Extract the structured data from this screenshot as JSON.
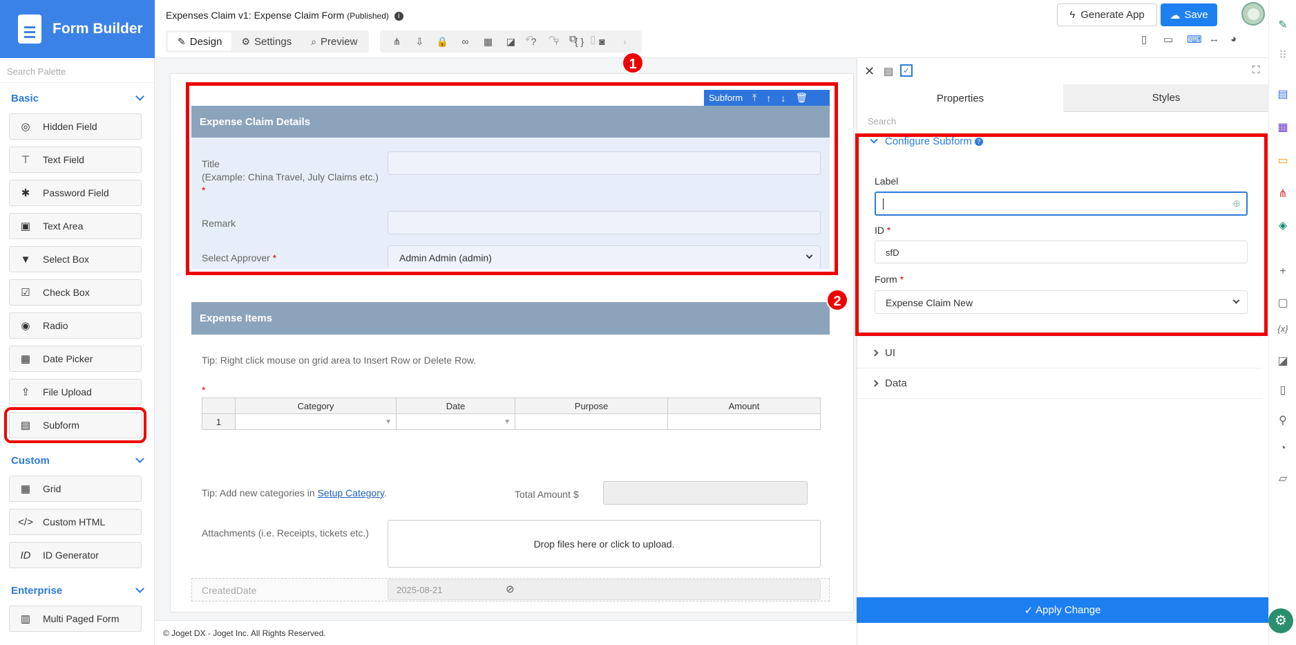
{
  "app": {
    "brand": "Form Builder"
  },
  "palette": {
    "search_placeholder": "Search Palette",
    "sections": {
      "basic": "Basic",
      "custom": "Custom",
      "enterprise": "Enterprise"
    },
    "basic_items": [
      "Hidden Field",
      "Text Field",
      "Password Field",
      "Text Area",
      "Select Box",
      "Check Box",
      "Radio",
      "Date Picker",
      "File Upload",
      "Subform"
    ],
    "custom_items": [
      "Grid",
      "Custom HTML",
      "ID Generator"
    ],
    "enterprise_items": [
      "Multi Paged Form"
    ]
  },
  "header": {
    "title": "Expenses Claim v1: Expense Claim Form",
    "status": "(Published)",
    "tabs": [
      "Design",
      "Settings",
      "Preview"
    ],
    "generate_label": "Generate App",
    "save_label": "Save"
  },
  "canvas": {
    "subform_toolbar_label": "Subform",
    "section1_title": "Expense Claim Details",
    "title_label": "Title",
    "title_hint": "(Example: China Travel, July Claims etc.)",
    "required_mark": "*",
    "remark_label": "Remark",
    "approver_label": "Select Approver",
    "approver_value": "Admin Admin (admin)",
    "section2_title": "Expense Items",
    "tip1": "Tip: Right click mouse on grid area to Insert Row or Delete Row.",
    "grid_headers": [
      "Category",
      "Date",
      "Purpose",
      "Amount"
    ],
    "grid_row_no": "1",
    "tip2_prefix": "Tip: Add new categories in ",
    "tip2_link": "Setup Category",
    "tip2_suffix": ".",
    "total_label": "Total Amount $",
    "attach_label": "Attachments (i.e. Receipts, tickets etc.)",
    "dropzone_text": "Drop files here or click to upload.",
    "created_label": "CreatedDate",
    "created_value": "2025-08-21",
    "badge1": "1",
    "badge2": "2"
  },
  "properties": {
    "tabs": [
      "Properties",
      "Styles"
    ],
    "search_placeholder": "Search",
    "configure_title": "Configure Subform",
    "label_label": "Label",
    "label_value": "",
    "id_label": "ID",
    "id_value": "sfD",
    "form_label": "Form",
    "form_value": "Expense Claim New",
    "ui_section": "UI",
    "data_section": "Data",
    "apply_label": "Apply Change"
  },
  "footer": {
    "text": "© Joget DX - Joget Inc. All Rights Reserved."
  },
  "colors": {
    "accent": "#1e7ff0",
    "highlight": "#e00000",
    "section_bar": "#8ca3bc"
  }
}
